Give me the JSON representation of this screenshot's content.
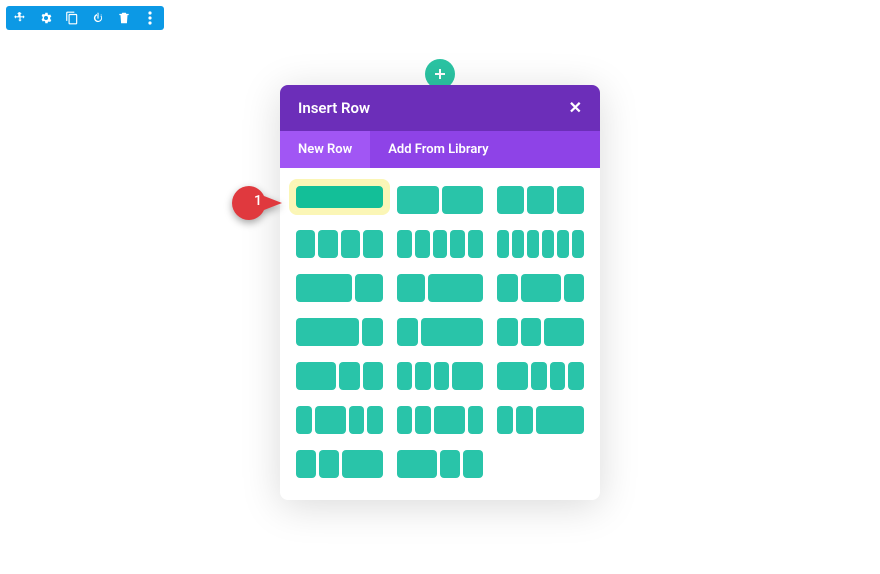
{
  "toolbar": {
    "icons": [
      "move-icon",
      "settings-icon",
      "duplicate-icon",
      "power-icon",
      "trash-icon",
      "more-icon"
    ]
  },
  "modal": {
    "title": "Insert Row",
    "tabs": {
      "new_row": "New Row",
      "add_from_library": "Add From Library"
    }
  },
  "annotation": {
    "number": "1"
  },
  "layouts": [
    {
      "id": "full",
      "cols": [
        1
      ],
      "highlight": true
    },
    {
      "id": "half-half",
      "cols": [
        1,
        1
      ]
    },
    {
      "id": "thirds",
      "cols": [
        1,
        1,
        1
      ]
    },
    {
      "id": "quarters",
      "cols": [
        1,
        1,
        1,
        1
      ]
    },
    {
      "id": "fifths",
      "cols": [
        1,
        1,
        1,
        1,
        1
      ]
    },
    {
      "id": "sixths",
      "cols": [
        1,
        1,
        1,
        1,
        1,
        1
      ]
    },
    {
      "id": "2-1",
      "cols": [
        2,
        1
      ]
    },
    {
      "id": "1-2",
      "cols": [
        1,
        2
      ]
    },
    {
      "id": "1-2-1",
      "cols": [
        1,
        2,
        1
      ]
    },
    {
      "id": "3-1",
      "cols": [
        3,
        1
      ]
    },
    {
      "id": "1-3",
      "cols": [
        1,
        3
      ]
    },
    {
      "id": "1-1-2",
      "cols": [
        1,
        1,
        2
      ]
    },
    {
      "id": "2-1-1",
      "cols": [
        2,
        1,
        1
      ]
    },
    {
      "id": "1-1-1-2",
      "cols": [
        1,
        1,
        1,
        2
      ]
    },
    {
      "id": "2-1-1-1",
      "cols": [
        2,
        1,
        1,
        1
      ]
    },
    {
      "id": "1-2-1-1",
      "cols": [
        1,
        2,
        1,
        1
      ]
    },
    {
      "id": "1-1-2-1",
      "cols": [
        1,
        1,
        2,
        1
      ]
    },
    {
      "id": "1-1-3",
      "cols": [
        1,
        1,
        3
      ]
    },
    {
      "id": "1-1-2b",
      "cols": [
        1,
        1,
        2
      ]
    },
    {
      "id": "2-1-1b",
      "cols": [
        2,
        1,
        1
      ]
    }
  ]
}
